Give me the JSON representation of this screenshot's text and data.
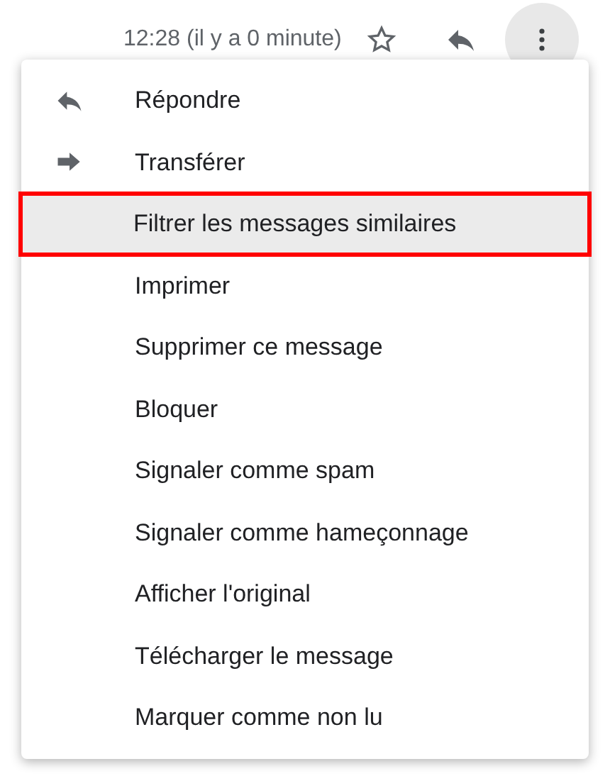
{
  "header": {
    "timestamp": "12:28 (il y a 0 minute)"
  },
  "menu": {
    "items": [
      {
        "label": "Répondre",
        "kind": "reply",
        "selected": false,
        "highlighted": false
      },
      {
        "label": "Transférer",
        "kind": "forward",
        "selected": false,
        "highlighted": false
      },
      {
        "label": "Filtrer les messages similaires",
        "kind": "plain",
        "selected": true,
        "highlighted": true
      },
      {
        "label": "Imprimer",
        "kind": "plain",
        "selected": false,
        "highlighted": false
      },
      {
        "label": "Supprimer ce message",
        "kind": "plain",
        "selected": false,
        "highlighted": false
      },
      {
        "label": "Bloquer",
        "kind": "plain",
        "selected": false,
        "highlighted": false
      },
      {
        "label": "Signaler comme spam",
        "kind": "plain",
        "selected": false,
        "highlighted": false
      },
      {
        "label": "Signaler comme hameçonnage",
        "kind": "plain",
        "selected": false,
        "highlighted": false
      },
      {
        "label": "Afficher l'original",
        "kind": "plain",
        "selected": false,
        "highlighted": false
      },
      {
        "label": "Télécharger le message",
        "kind": "plain",
        "selected": false,
        "highlighted": false
      },
      {
        "label": "Marquer comme non lu",
        "kind": "plain",
        "selected": false,
        "highlighted": false
      }
    ]
  }
}
